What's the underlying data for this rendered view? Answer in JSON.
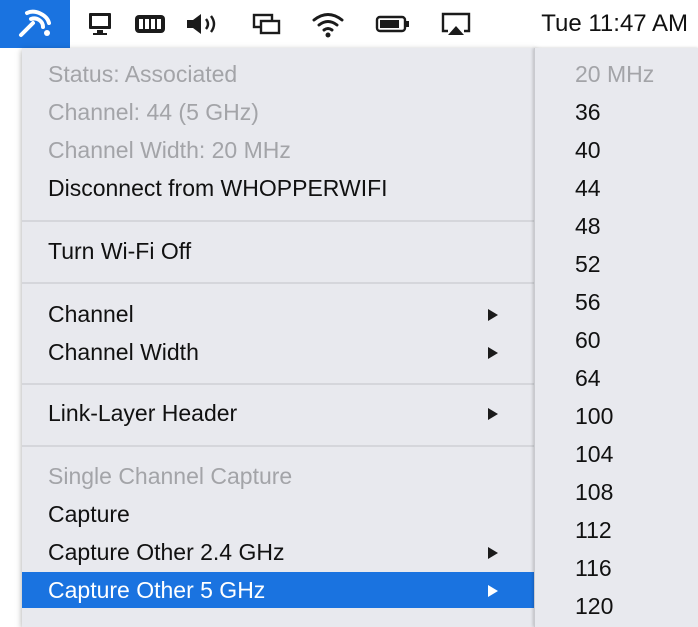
{
  "menubar": {
    "icons": [
      "wireless-diagnostics-icon",
      "display-icon",
      "battery-box-icon",
      "volume-icon",
      "window-icon",
      "wifi-icon",
      "battery-icon",
      "airplay-icon"
    ],
    "clock": "Tue 11:47 AM",
    "accent": "#1a73e0"
  },
  "menu": {
    "status": "Status: Associated",
    "channel": "Channel: 44 (5 GHz)",
    "channel_width": "Channel Width: 20 MHz",
    "disconnect": "Disconnect from WHOPPERWIFI",
    "turn_off": "Turn Wi-Fi Off",
    "channel_menu": "Channel",
    "channel_width_menu": "Channel Width",
    "link_layer": "Link-Layer Header",
    "single_capture": "Single Channel Capture",
    "capture": "Capture",
    "capture_24": "Capture Other 2.4 GHz",
    "capture_5": "Capture Other 5 GHz"
  },
  "submenu": {
    "header": "20 MHz",
    "items": [
      "36",
      "40",
      "44",
      "48",
      "52",
      "56",
      "60",
      "64",
      "100",
      "104",
      "108",
      "112",
      "116",
      "120"
    ]
  }
}
